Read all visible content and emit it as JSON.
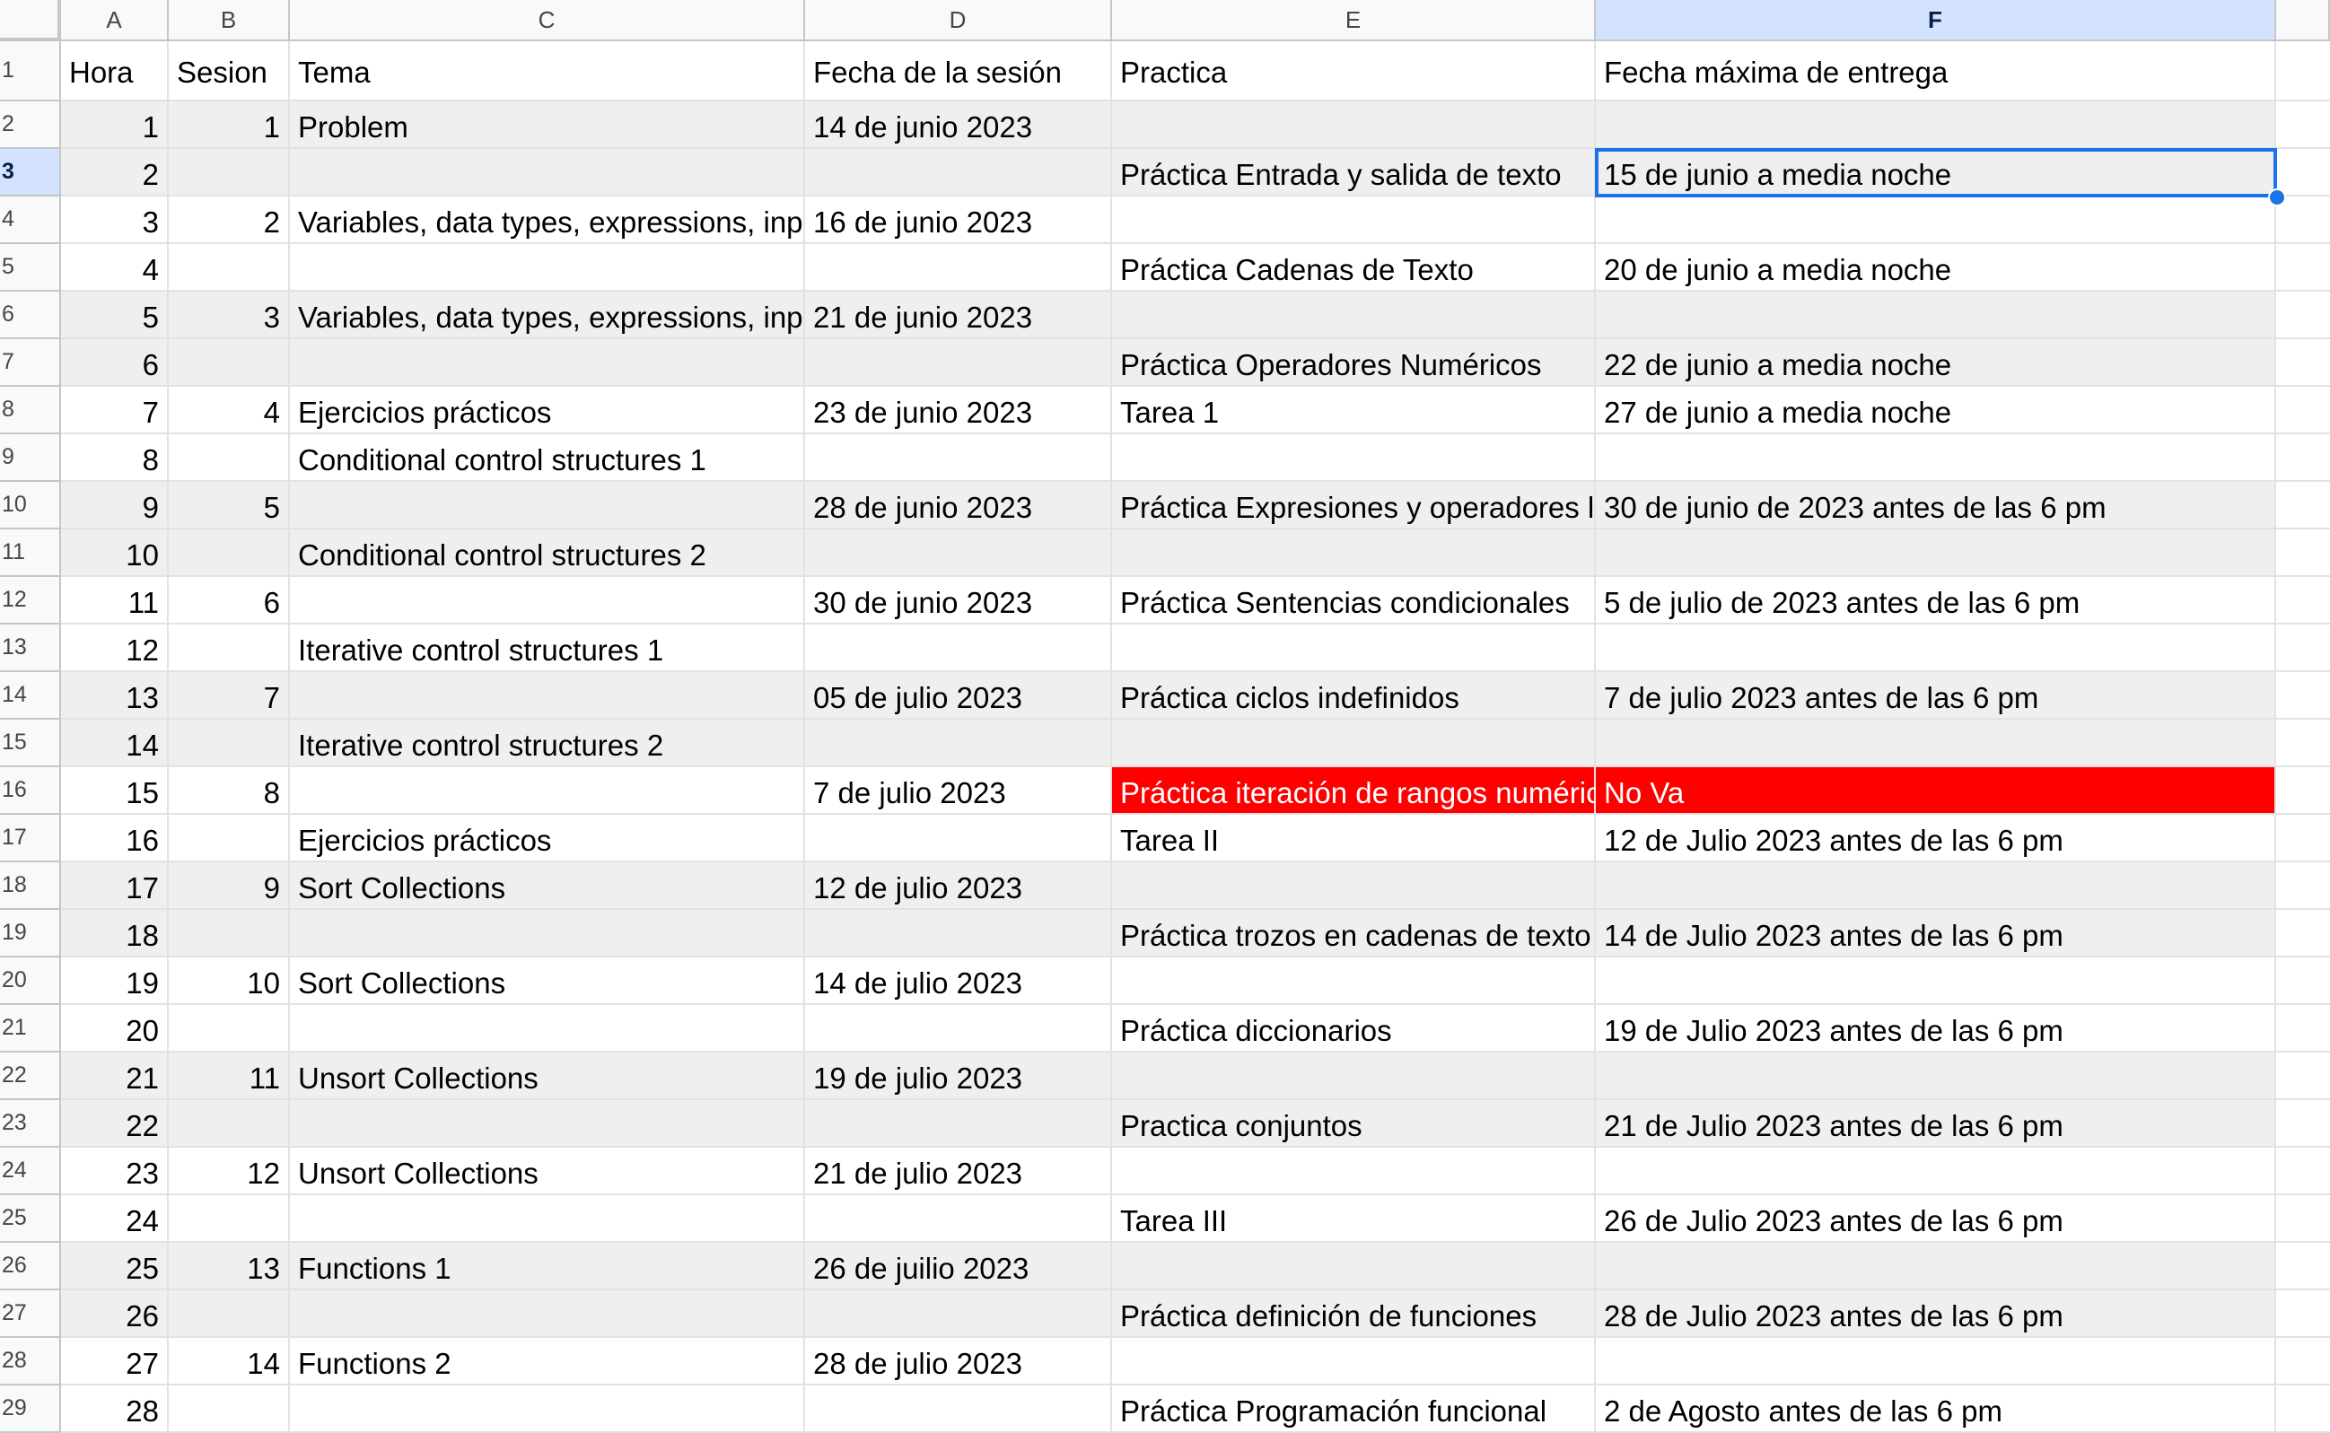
{
  "column_headers": [
    "A",
    "B",
    "C",
    "D",
    "E",
    "F"
  ],
  "selected_column": "F",
  "selected_cell": "F3",
  "colors": {
    "band": "#efefef",
    "red_fill": "#ff0000",
    "selection": "#1a73e8",
    "header_selected": "#d3e3fd"
  },
  "rows": [
    {
      "n": "1",
      "band": false,
      "cells": [
        "Hora",
        "Sesion",
        "Tema",
        "Fecha de la sesión",
        "Practica",
        "Fecha máxima de entrega"
      ]
    },
    {
      "n": "2",
      "band": true,
      "cells": [
        "1",
        "1",
        "Problem",
        "14 de junio 2023",
        "",
        ""
      ]
    },
    {
      "n": "3",
      "band": true,
      "cells": [
        "2",
        "",
        "",
        "",
        "Práctica Entrada y salida de texto",
        "15 de junio a media noche"
      ]
    },
    {
      "n": "4",
      "band": false,
      "cells": [
        "3",
        "2",
        "Variables, data types, expressions, input/output",
        "16 de junio 2023",
        "",
        ""
      ]
    },
    {
      "n": "5",
      "band": false,
      "cells": [
        "4",
        "",
        "",
        "",
        "Práctica Cadenas de Texto",
        "20 de junio a media noche"
      ]
    },
    {
      "n": "6",
      "band": true,
      "cells": [
        "5",
        "3",
        "Variables, data types, expressions, input/output",
        "21 de junio 2023",
        "",
        ""
      ]
    },
    {
      "n": "7",
      "band": true,
      "cells": [
        "6",
        "",
        "",
        "",
        "Práctica Operadores Numéricos",
        "22 de junio a media noche"
      ]
    },
    {
      "n": "8",
      "band": false,
      "cells": [
        "7",
        "4",
        "Ejercicios prácticos",
        "23 de junio 2023",
        "Tarea 1",
        "27 de junio a media noche"
      ]
    },
    {
      "n": "9",
      "band": false,
      "cells": [
        "8",
        "",
        "Conditional control structures 1",
        "",
        "",
        ""
      ]
    },
    {
      "n": "10",
      "band": true,
      "cells": [
        "9",
        "5",
        "",
        "28 de junio 2023",
        "Práctica Expresiones y operadores lógicos",
        "30 de junio de 2023 antes de las 6 pm"
      ]
    },
    {
      "n": "11",
      "band": true,
      "cells": [
        "10",
        "",
        "Conditional control structures 2",
        "",
        "",
        ""
      ]
    },
    {
      "n": "12",
      "band": false,
      "cells": [
        "11",
        "6",
        "",
        "30 de junio 2023",
        "Práctica Sentencias condicionales",
        "5 de julio de 2023 antes de las 6 pm"
      ]
    },
    {
      "n": "13",
      "band": false,
      "cells": [
        "12",
        "",
        "Iterative control structures 1",
        "",
        "",
        ""
      ]
    },
    {
      "n": "14",
      "band": true,
      "cells": [
        "13",
        "7",
        "",
        "05 de julio 2023",
        "Práctica ciclos indefinidos",
        "7 de julio 2023 antes de las 6 pm"
      ]
    },
    {
      "n": "15",
      "band": true,
      "cells": [
        "14",
        "",
        "Iterative control structures 2",
        "",
        "",
        ""
      ]
    },
    {
      "n": "16",
      "band": false,
      "red": true,
      "cells": [
        "15",
        "8",
        "",
        "7 de julio 2023",
        "Práctica iteración de rangos numéricos",
        "No Va"
      ]
    },
    {
      "n": "17",
      "band": false,
      "cells": [
        "16",
        "",
        "Ejercicios prácticos",
        "",
        "Tarea II",
        "12 de Julio 2023 antes de las 6 pm"
      ]
    },
    {
      "n": "18",
      "band": true,
      "cells": [
        "17",
        "9",
        "Sort Collections",
        "12 de julio 2023",
        "",
        ""
      ]
    },
    {
      "n": "19",
      "band": true,
      "cells": [
        "18",
        "",
        "",
        "",
        "Práctica trozos en cadenas de texto",
        "14 de Julio 2023 antes de las 6 pm"
      ]
    },
    {
      "n": "20",
      "band": false,
      "cells": [
        "19",
        "10",
        "Sort Collections",
        "14 de julio 2023",
        "",
        ""
      ]
    },
    {
      "n": "21",
      "band": false,
      "cells": [
        "20",
        "",
        "",
        "",
        "Práctica diccionarios",
        "19 de Julio 2023 antes de las 6 pm"
      ]
    },
    {
      "n": "22",
      "band": true,
      "cells": [
        "21",
        "11",
        "Unsort Collections",
        "19 de julio 2023",
        "",
        ""
      ]
    },
    {
      "n": "23",
      "band": true,
      "cells": [
        "22",
        "",
        "",
        "",
        "Practica conjuntos",
        "21 de Julio 2023 antes de las 6 pm"
      ]
    },
    {
      "n": "24",
      "band": false,
      "cells": [
        "23",
        "12",
        "Unsort Collections",
        "21 de julio 2023",
        "",
        ""
      ]
    },
    {
      "n": "25",
      "band": false,
      "cells": [
        "24",
        "",
        "",
        "",
        "Tarea III",
        "26 de Julio 2023 antes de las 6 pm"
      ]
    },
    {
      "n": "26",
      "band": true,
      "cells": [
        "25",
        "13",
        "Functions 1",
        "26 de juilio 2023",
        "",
        ""
      ]
    },
    {
      "n": "27",
      "band": true,
      "cells": [
        "26",
        "",
        "",
        "",
        "Práctica definición de funciones",
        "28 de Julio 2023 antes de las 6 pm"
      ]
    },
    {
      "n": "28",
      "band": false,
      "cells": [
        "27",
        "14",
        "Functions 2",
        "28 de julio 2023",
        "",
        ""
      ]
    },
    {
      "n": "29",
      "band": false,
      "cells": [
        "28",
        "",
        "",
        "",
        "Práctica Programación funcional",
        "2 de Agosto antes de las 6 pm"
      ]
    }
  ]
}
